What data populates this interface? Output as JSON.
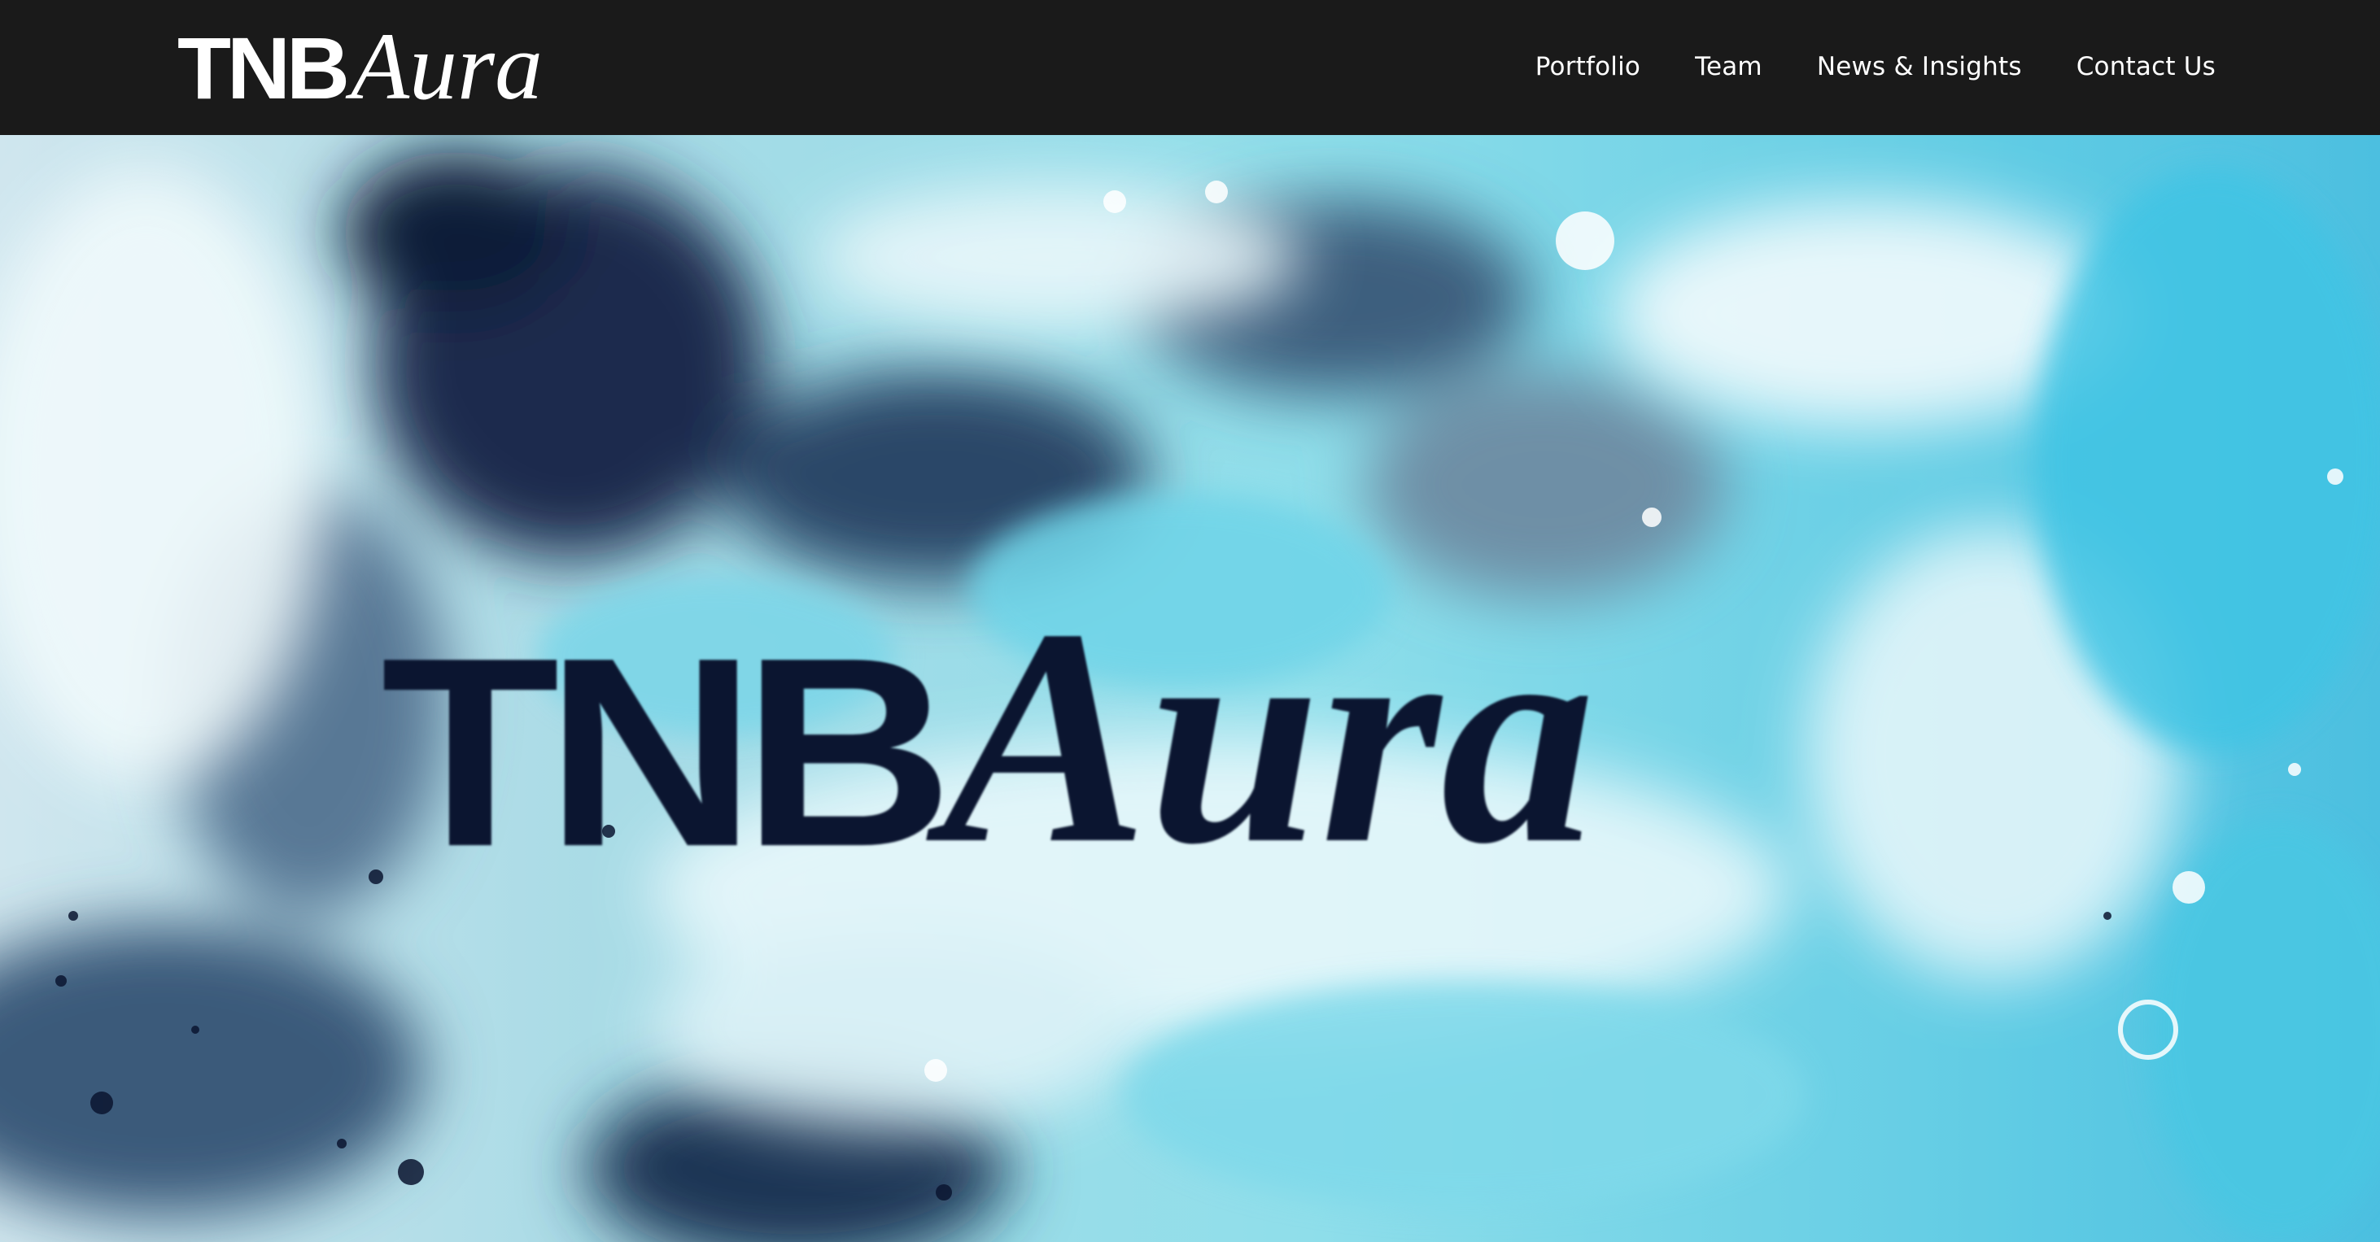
{
  "header": {
    "logo": {
      "bold_text": "TNB",
      "italic_text": "Aura"
    },
    "nav": {
      "items": [
        {
          "label": "Portfolio"
        },
        {
          "label": "Team"
        },
        {
          "label": "News & Insights"
        },
        {
          "label": "Contact Us"
        }
      ]
    }
  },
  "hero": {
    "title_bold": "TNB",
    "title_italic": "Aura"
  },
  "colors": {
    "header_bg": "#1a1a1a",
    "nav_text": "#ffffff",
    "hero_cyan": "#5fd0e6",
    "hero_navy": "#0b1530",
    "hero_white": "#eef8fa"
  }
}
